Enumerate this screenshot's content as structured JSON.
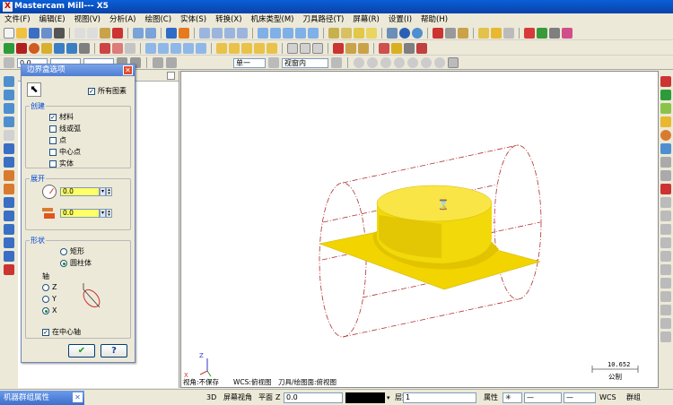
{
  "window": {
    "title": "Mastercam Mill--- X5",
    "app_icon": "X"
  },
  "menu": [
    "文件(F)",
    "编辑(E)",
    "视图(V)",
    "分析(A)",
    "绘图(C)",
    "实体(S)",
    "转换(X)",
    "机床类型(M)",
    "刀具路径(T)",
    "屏幕(R)",
    "设置(I)",
    "帮助(H)"
  ],
  "ribbon": {
    "value1": "0.0",
    "layer_field": "单一",
    "view_field": "视窗内"
  },
  "dialog": {
    "title": "边界盒选项",
    "all_entities_label": "所有图素",
    "all_entities_checked": true,
    "create_group": "创建",
    "create_options": [
      {
        "label": "材料",
        "checked": true
      },
      {
        "label": "线或弧",
        "checked": false
      },
      {
        "label": "点",
        "checked": false
      },
      {
        "label": "中心点",
        "checked": false
      },
      {
        "label": "实体",
        "checked": false
      }
    ],
    "expand_group": "展开",
    "expand_values": [
      "0.0",
      "0.0"
    ],
    "shape_group": "形状",
    "shape_options": [
      {
        "label": "矩形",
        "selected": false
      },
      {
        "label": "圆柱体",
        "selected": true
      }
    ],
    "axis_label": "轴",
    "axis_options": [
      {
        "label": "Z",
        "selected": false
      },
      {
        "label": "Y",
        "selected": false
      },
      {
        "label": "X",
        "selected": true
      }
    ],
    "centered_label": "在中心轴",
    "centered_checked": true,
    "ok_glyph": "✔",
    "help_glyph": "?"
  },
  "viewport": {
    "axis_labels": {
      "z": "Z",
      "x": "X",
      "y": "Y"
    },
    "view_label": "视角:不保存",
    "wcs_label": "WCS:俯视图",
    "tool_plane_label": "刀具/绘图面:俯视图",
    "scale_value": "10.652",
    "scale_unit": "公制"
  },
  "statusbar": {
    "machine_tab": "机器群组属性",
    "mode_3d": "3D",
    "screen_view": "屏幕视角",
    "plane": "平面",
    "z_label": "Z",
    "z_value": "0.0",
    "layer_label": "层别",
    "layer_value": "1",
    "attributes": "属性",
    "wcs": "WCS",
    "group": "群组"
  },
  "colors": {
    "title_blue": "#0842a8",
    "part_yellow": "#f2d400",
    "boundary_red": "#b03030"
  }
}
